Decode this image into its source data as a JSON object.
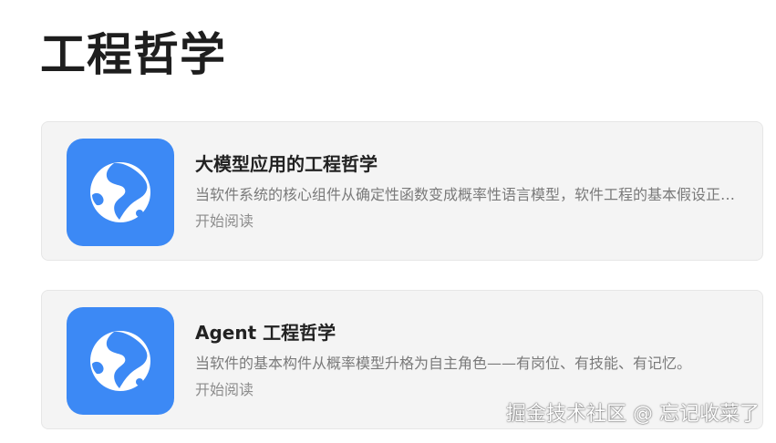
{
  "page": {
    "title": "工程哲学"
  },
  "colors": {
    "icon_background": "#3c89f5",
    "card_background": "#f4f4f4"
  },
  "cards": [
    {
      "icon": "globe-icon",
      "title": "大模型应用的工程哲学",
      "description": "当软件系统的核心组件从确定性函数变成概率性语言模型，软件工程的基本假设正在被重写。",
      "action": "开始阅读"
    },
    {
      "icon": "globe-icon",
      "title": "Agent 工程哲学",
      "description": "当软件的基本构件从概率模型升格为自主角色——有岗位、有技能、有记忆。",
      "action": "开始阅读"
    }
  ],
  "watermark": "掘金技术社区 @ 忘记收菜了"
}
